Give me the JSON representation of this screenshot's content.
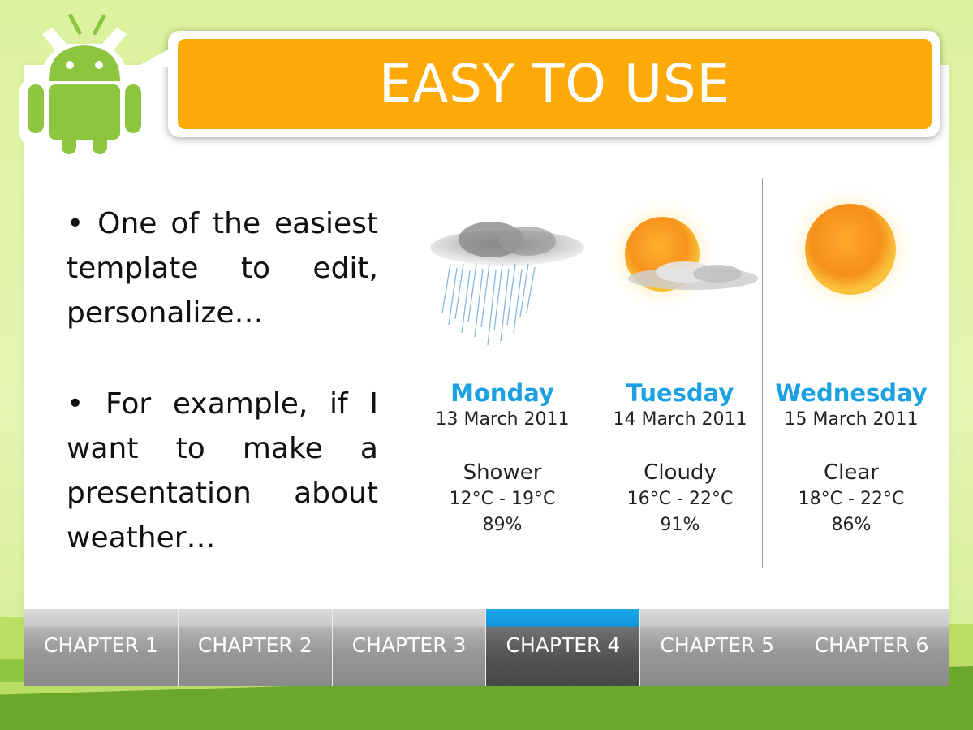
{
  "title": "EASY TO USE",
  "bullets": [
    "• One of the easiest template to edit, personalize…",
    "• For example, if I want to make a presentation about weather…"
  ],
  "weather": [
    {
      "day": "Monday",
      "date": "13 March 2011",
      "condition": "Shower",
      "temp": "12°C - 19°C",
      "humidity": "89%",
      "icon": "rain-cloud-icon"
    },
    {
      "day": "Tuesday",
      "date": "14 March 2011",
      "condition": "Cloudy",
      "temp": "16°C - 22°C",
      "humidity": "91%",
      "icon": "sun-cloud-icon"
    },
    {
      "day": "Wednesday",
      "date": "15 March 2011",
      "condition": "Clear",
      "temp": "18°C - 22°C",
      "humidity": "86%",
      "icon": "sun-icon"
    }
  ],
  "tabs": [
    {
      "label": "CHAPTER 1",
      "active": false
    },
    {
      "label": "CHAPTER 2",
      "active": false
    },
    {
      "label": "CHAPTER 3",
      "active": false
    },
    {
      "label": "CHAPTER 4",
      "active": true
    },
    {
      "label": "CHAPTER 5",
      "active": false
    },
    {
      "label": "CHAPTER 6",
      "active": false
    }
  ],
  "colors": {
    "title_bar": "#fdaa08",
    "day_name": "#1ba1e2",
    "active_tab": "#1aa7ec",
    "android_green": "#8cc63f"
  },
  "logo": "android-robot-icon"
}
